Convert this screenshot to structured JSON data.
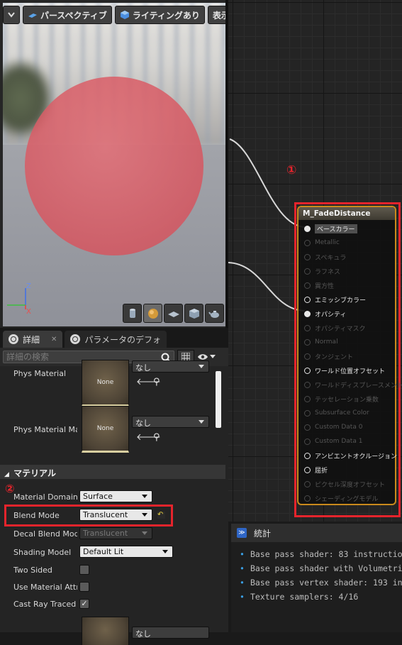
{
  "viewport": {
    "perspective_label": "パースペクティブ",
    "lighting_label": "ライティングあり",
    "show_label": "表示",
    "axis_z": "Z",
    "axis_x": "X"
  },
  "graph": {
    "annotation": "①",
    "node": {
      "title": "M_FadeDistance",
      "pins": [
        {
          "label": "ベースカラー",
          "state": "on"
        },
        {
          "label": "Metallic",
          "state": "off"
        },
        {
          "label": "スペキュラ",
          "state": "off"
        },
        {
          "label": "ラフネス",
          "state": "off"
        },
        {
          "label": "異方性",
          "state": "off"
        },
        {
          "label": "エミッシブカラー",
          "state": "on"
        },
        {
          "label": "オパシティ",
          "state": "on"
        },
        {
          "label": "オパシティマスク",
          "state": "off"
        },
        {
          "label": "Normal",
          "state": "off"
        },
        {
          "label": "タンジェント",
          "state": "off"
        },
        {
          "label": "ワールド位置オフセット",
          "state": "on"
        },
        {
          "label": "ワールドディスプレースメント",
          "state": "off"
        },
        {
          "label": "テッセレーション乗数",
          "state": "off"
        },
        {
          "label": "Subsurface Color",
          "state": "off"
        },
        {
          "label": "Custom Data 0",
          "state": "off"
        },
        {
          "label": "Custom Data 1",
          "state": "off"
        },
        {
          "label": "アンビエントオクルージョン",
          "state": "on"
        },
        {
          "label": "屈折",
          "state": "on"
        },
        {
          "label": "ピクセル深度オフセット",
          "state": "off"
        },
        {
          "label": "シェーディングモデル",
          "state": "off"
        }
      ]
    }
  },
  "details": {
    "tab_details": "詳細",
    "tab_params": "パラメータのデフォ",
    "search_placeholder": "詳細の検索",
    "phys_material": {
      "label": "Phys Material",
      "thumb": "None",
      "value": "なし"
    },
    "phys_material_mask": {
      "label": "Phys Material Ma",
      "thumb": "None",
      "value": "なし"
    },
    "section_material": "マテリアル",
    "annotation": "②",
    "material_domain": {
      "label": "Material Domain",
      "value": "Surface"
    },
    "blend_mode": {
      "label": "Blend Mode",
      "value": "Translucent"
    },
    "decal_blend_mode": {
      "label": "Decal Blend Mode",
      "value": "Translucent"
    },
    "shading_model": {
      "label": "Shading Model",
      "value": "Default Lit"
    },
    "two_sided": {
      "label": "Two Sided",
      "checked": false
    },
    "use_material_attr": {
      "label": "Use Material Attri",
      "checked": false
    },
    "cast_ray_traced": {
      "label": "Cast Ray Traced S",
      "checked": true,
      "mark": "✓"
    },
    "last_value": "なし"
  },
  "stats": {
    "tab_label": "統計",
    "lines": [
      "Base pass shader: 83 instructio",
      "Base pass shader with Volumetri",
      "Base pass vertex shader: 193 in",
      "Texture samplers: 4/16"
    ]
  },
  "colors": {
    "annotation_red": "#e5242c",
    "node_border": "#c98a1c",
    "sphere": "#d6606a",
    "stats_bullet": "#3aa0e6"
  }
}
